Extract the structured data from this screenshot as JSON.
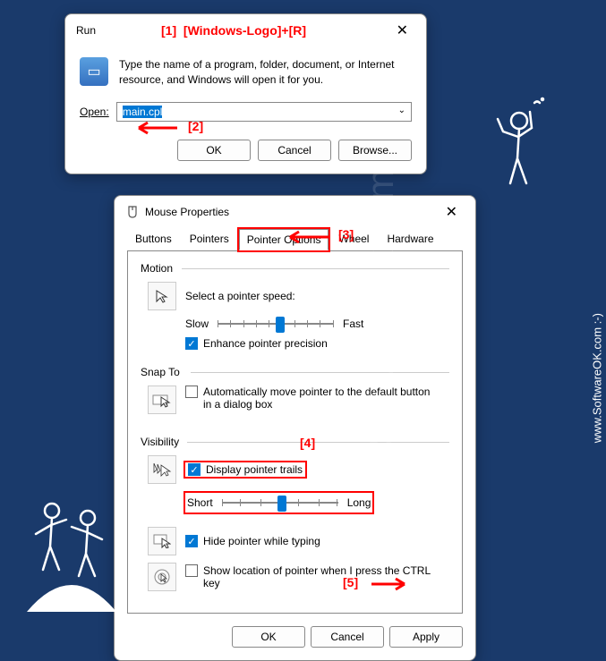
{
  "annotations": {
    "a1": "[1]",
    "a1_text": "[Windows-Logo]+[R]",
    "a2": "[2]",
    "a3": "[3]",
    "a4": "[4]",
    "a5": "[5]"
  },
  "watermark": {
    "main": "SoftwareOk.com",
    "side": "www.SoftwareOK.com  :-)"
  },
  "run": {
    "title": "Run",
    "desc": "Type the name of a program, folder, document, or Internet resource, and Windows will open it for you.",
    "open_label": "Open:",
    "open_value": "main.cpl",
    "ok": "OK",
    "cancel": "Cancel",
    "browse": "Browse..."
  },
  "mouse": {
    "title": "Mouse Properties",
    "tabs": {
      "buttons": "Buttons",
      "pointers": "Pointers",
      "pointer_options": "Pointer Options",
      "wheel": "Wheel",
      "hardware": "Hardware"
    },
    "motion": {
      "title": "Motion",
      "select_speed": "Select a pointer speed:",
      "slow": "Slow",
      "fast": "Fast",
      "enhance": "Enhance pointer precision"
    },
    "snap": {
      "title": "Snap To",
      "auto_move": "Automatically move pointer to the default button in a dialog box"
    },
    "visibility": {
      "title": "Visibility",
      "trails": "Display pointer trails",
      "short": "Short",
      "long": "Long",
      "hide_typing": "Hide pointer while typing",
      "show_ctrl": "Show location of pointer when I press the CTRL key"
    },
    "ok": "OK",
    "cancel": "Cancel",
    "apply": "Apply"
  }
}
